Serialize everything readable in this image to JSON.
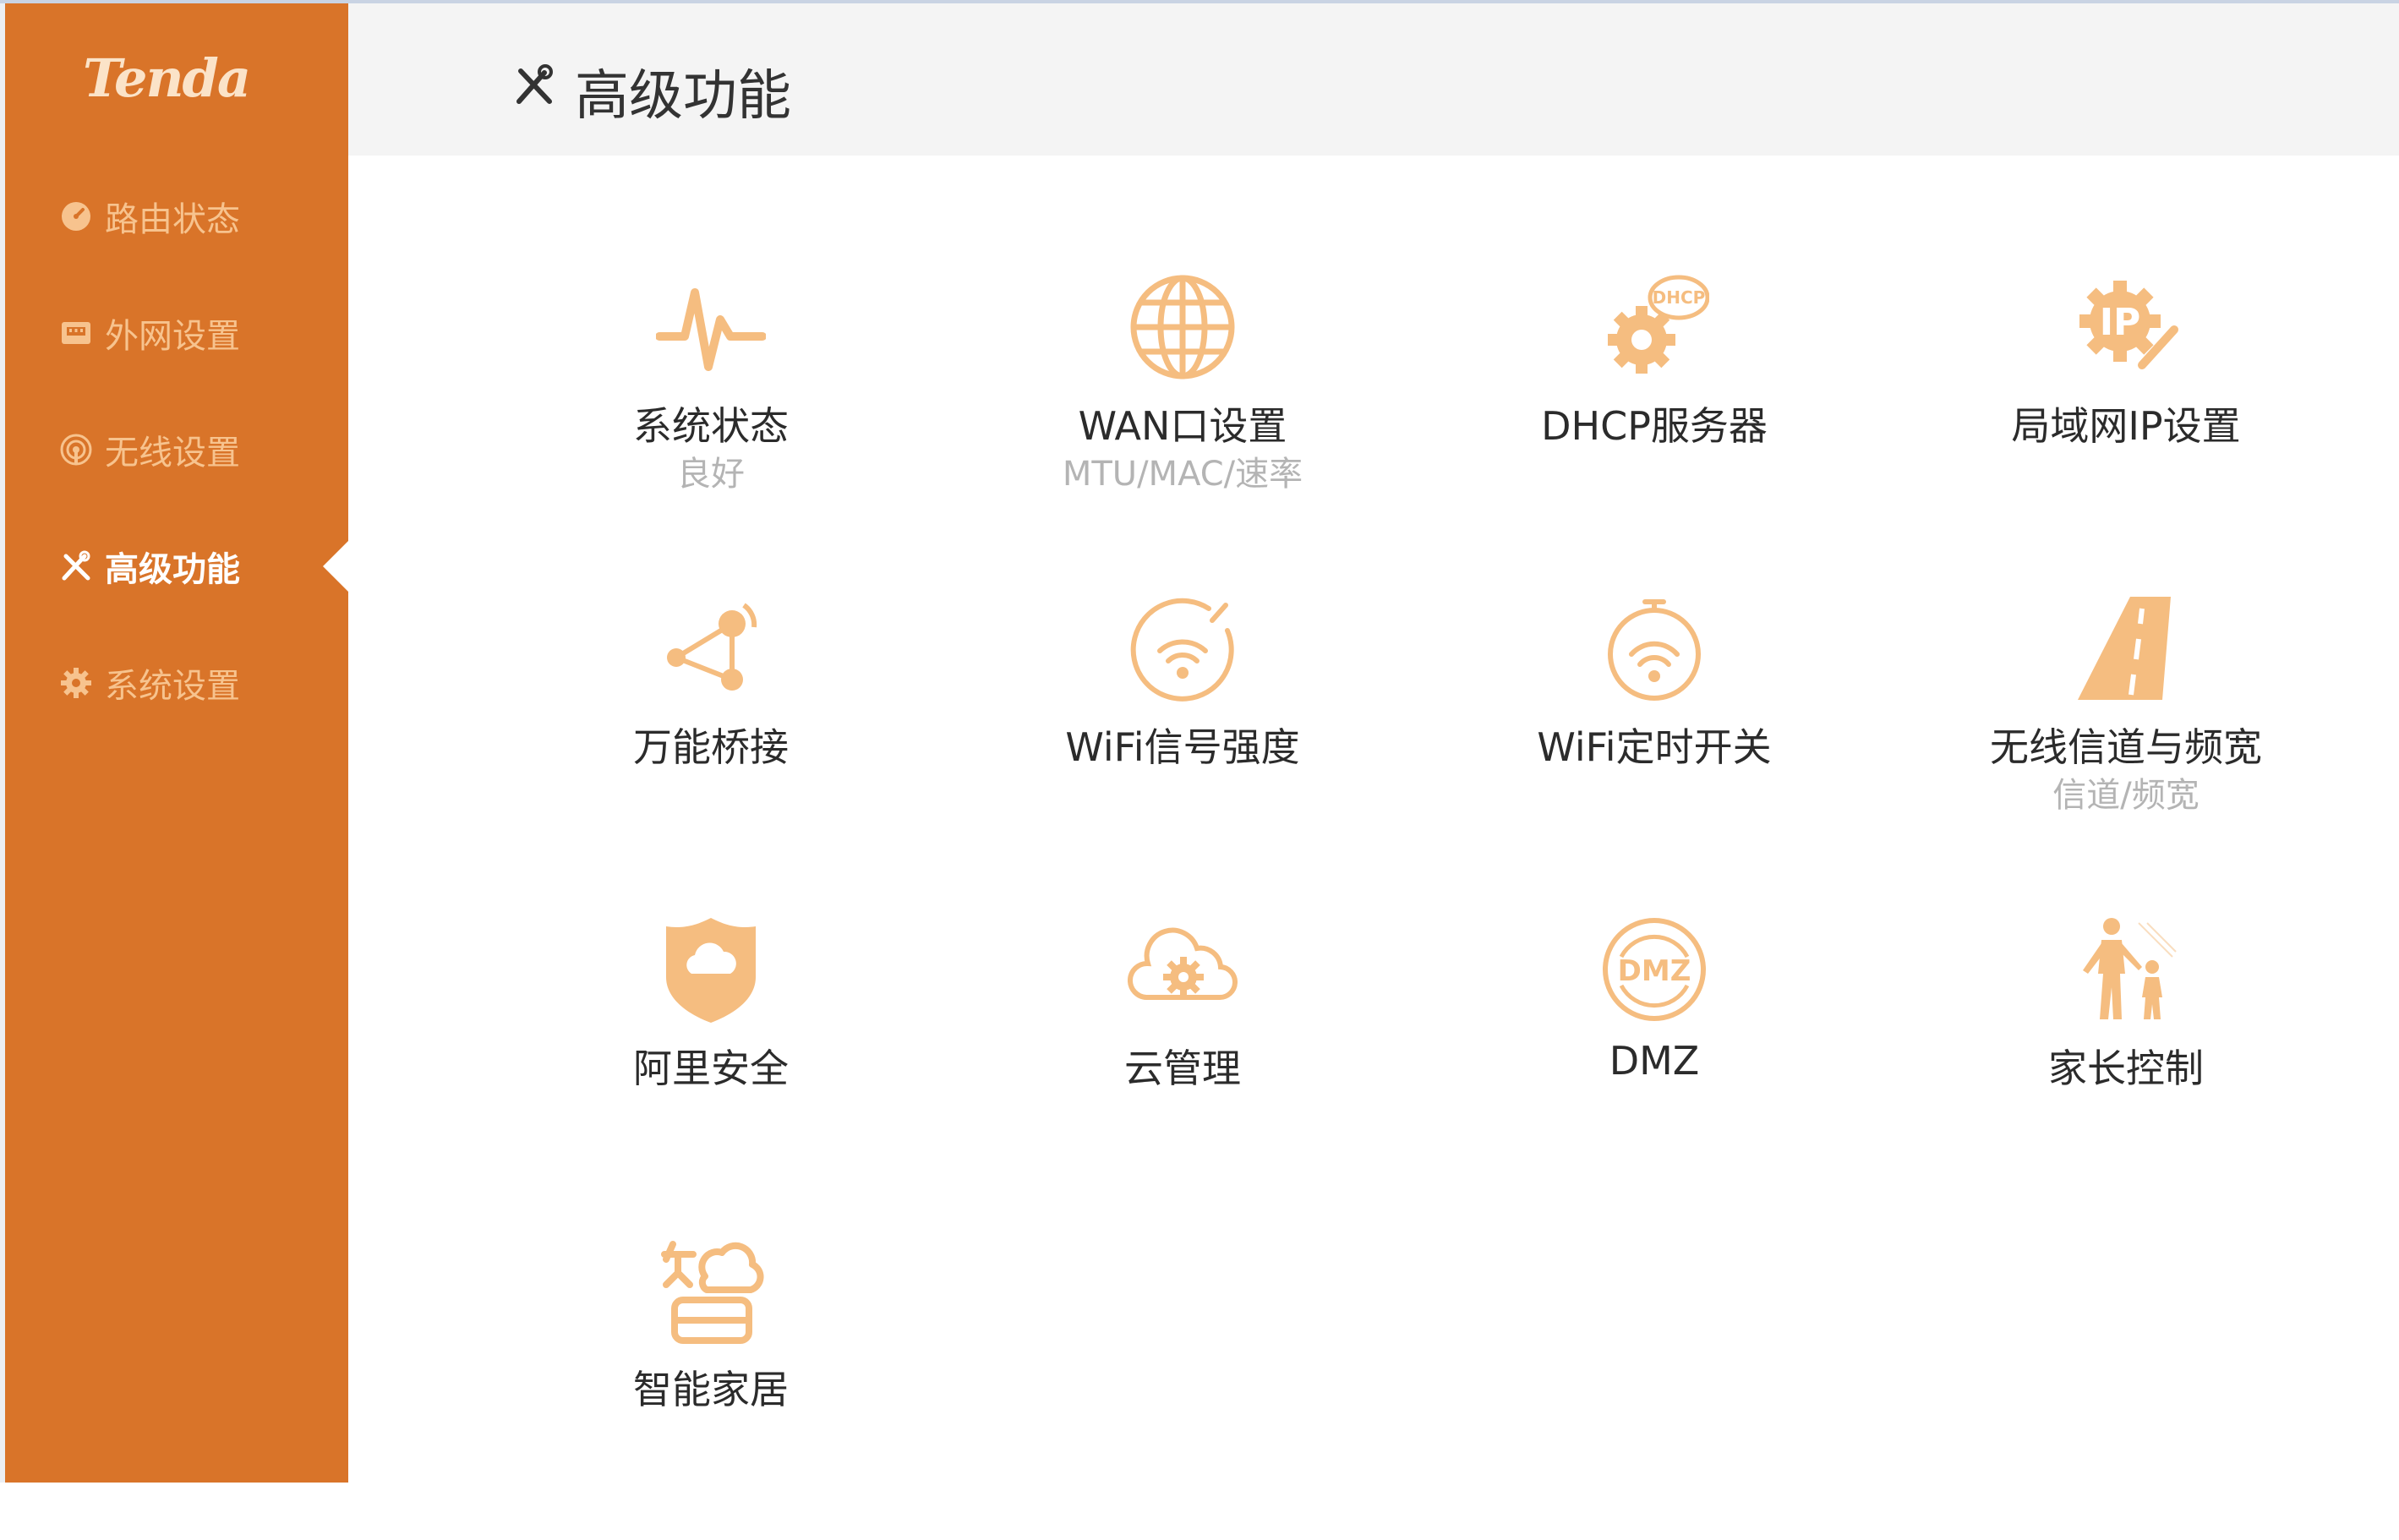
{
  "brand": {
    "logo_text": "Tenda"
  },
  "colors": {
    "sidebar_bg": "#d97429",
    "icon_accent": "#f5bd80",
    "nav_text": "#f7c38e",
    "header_bg": "#f4f4f4"
  },
  "sidebar": {
    "items": [
      {
        "label": "路由状态",
        "icon": "dashboard-icon",
        "active": false
      },
      {
        "label": "外网设置",
        "icon": "network-port-icon",
        "active": false
      },
      {
        "label": "无线设置",
        "icon": "wireless-icon",
        "active": false
      },
      {
        "label": "高级功能",
        "icon": "tools-icon",
        "active": true
      },
      {
        "label": "系统设置",
        "icon": "gear-icon",
        "active": false
      }
    ]
  },
  "header": {
    "title": "高级功能",
    "icon": "tools-icon"
  },
  "features": [
    {
      "title": "系统状态",
      "subtitle": "良好",
      "icon": "pulse-icon"
    },
    {
      "title": "WAN口设置",
      "subtitle": "MTU/MAC/速率",
      "icon": "globe-icon"
    },
    {
      "title": "DHCP服务器",
      "subtitle": "",
      "icon": "dhcp-gear-icon"
    },
    {
      "title": "局域网IP设置",
      "subtitle": "",
      "icon": "ip-gear-icon"
    },
    {
      "title": "万能桥接",
      "subtitle": "",
      "icon": "bridge-icon"
    },
    {
      "title": "WiFi信号强度",
      "subtitle": "",
      "icon": "wifi-signal-icon"
    },
    {
      "title": "WiFi定时开关",
      "subtitle": "",
      "icon": "wifi-timer-icon"
    },
    {
      "title": "无线信道与频宽",
      "subtitle": "信道/频宽",
      "icon": "road-icon"
    },
    {
      "title": "阿里安全",
      "subtitle": "",
      "icon": "shield-cloud-icon"
    },
    {
      "title": "云管理",
      "subtitle": "",
      "icon": "cloud-gear-icon"
    },
    {
      "title": "DMZ",
      "subtitle": "",
      "icon": "dmz-icon"
    },
    {
      "title": "家长控制",
      "subtitle": "",
      "icon": "parent-child-icon"
    },
    {
      "title": "智能家居",
      "subtitle": "",
      "icon": "smart-home-icon"
    }
  ]
}
